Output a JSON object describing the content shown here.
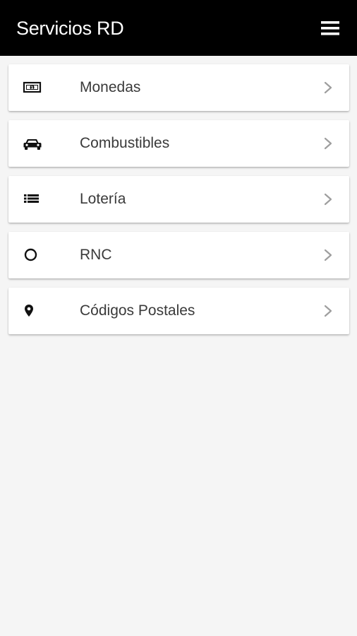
{
  "header": {
    "title": "Servicios RD",
    "menu_icon": "hamburger-menu-icon",
    "background": "#000000"
  },
  "menu": {
    "items": [
      {
        "label": "Monedas",
        "icon": "money-bill-icon"
      },
      {
        "label": "Combustibles",
        "icon": "car-icon"
      },
      {
        "label": "Lotería",
        "icon": "list-icon"
      },
      {
        "label": "RNC",
        "icon": "circle-icon"
      },
      {
        "label": "Códigos Postales",
        "icon": "map-pin-icon"
      }
    ],
    "chevron_icon": "chevron-right-icon"
  }
}
